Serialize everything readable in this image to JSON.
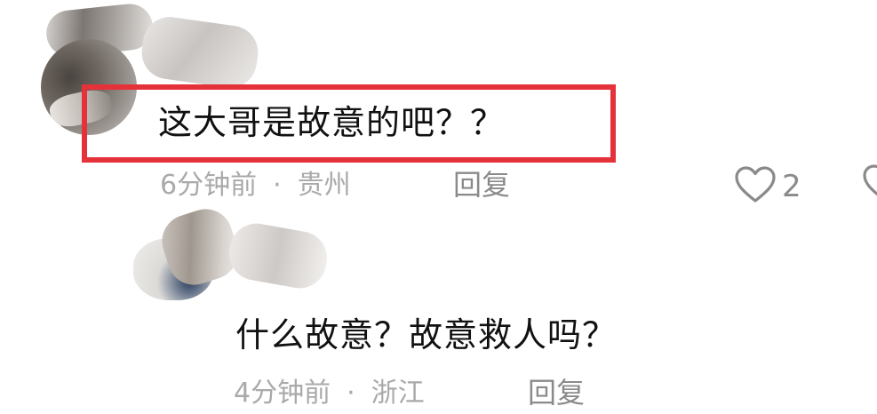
{
  "comments": [
    {
      "text": "这大哥是故意的吧？？",
      "time": "6分钟前",
      "separator": "·",
      "location": "贵州",
      "reply_label": "回复",
      "like_count": "2",
      "highlighted": true
    },
    {
      "text": "什么故意？故意救人吗？",
      "time": "4分钟前",
      "separator": "·",
      "location": "浙江",
      "reply_label": "回复"
    }
  ],
  "colors": {
    "highlight_border": "#e5323a",
    "primary_text": "#111111",
    "meta_text": "#a9a9a9",
    "icon": "#8a8a8a"
  },
  "icons": {
    "like": "heart-outline-icon",
    "edge": "heart-outline-icon"
  }
}
